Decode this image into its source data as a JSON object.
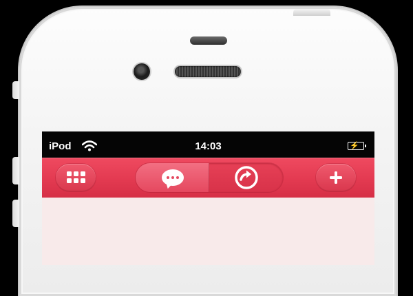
{
  "statusbar": {
    "carrier": "iPod",
    "time": "14:03",
    "wifi_icon": "wifi-icon",
    "battery_icon": "battery-charging-icon"
  },
  "navbar": {
    "left_button_icon": "grid-menu-icon",
    "right_button_icon": "plus-icon",
    "segments": [
      {
        "icon": "chat-bubble-icon",
        "selected": true
      },
      {
        "icon": "arrow-circle-right-icon",
        "selected": false
      }
    ]
  },
  "colors": {
    "accent": "#e33a51",
    "selected_segment": "#ee6074",
    "content_background": "#f8eaea",
    "device_body": "#f4f4f4"
  }
}
